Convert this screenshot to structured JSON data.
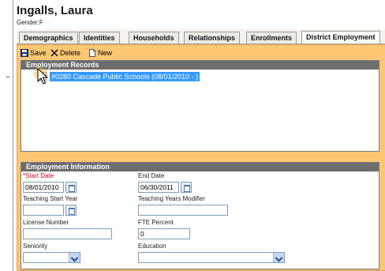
{
  "student": {
    "name": "Ingalls, Laura",
    "gender_line": "Gender:F"
  },
  "tabs": [
    {
      "label": "Demographics",
      "active": false
    },
    {
      "label": "Identities",
      "active": false
    },
    {
      "label": "Households",
      "active": false
    },
    {
      "label": "Relationships",
      "active": false
    },
    {
      "label": "Enrollments",
      "active": false
    },
    {
      "label": "District Employment",
      "active": true
    }
  ],
  "toolbar": {
    "save": "Save",
    "delete": "Delete",
    "new": "New"
  },
  "records": {
    "header": "Employment Records",
    "items": [
      "#0280 Cascade Public Schools (08/01/2010 - )"
    ]
  },
  "info": {
    "header": "Employment Information",
    "start_date_label": "*Start Date",
    "start_date_value": "08/01/2010",
    "end_date_label": "End Date",
    "end_date_value": "06/30/2011",
    "teaching_start_year_label": "Teaching Start Year",
    "teaching_start_year_value": "",
    "teaching_years_modifier_label": "Teaching Years Modifier",
    "teaching_years_modifier_value": "",
    "license_number_label": "License Number",
    "license_number_value": "",
    "fte_percent_label": "FTE Percent",
    "fte_percent_value": "0",
    "seniority_label": "Seniority",
    "seniority_value": "",
    "education_label": "Education",
    "education_value": ""
  },
  "colors": {
    "content_background": "#fdc672",
    "panel_header": "#6d6d6d",
    "selected_row": "#3399ff",
    "required_label": "#d0021b"
  }
}
